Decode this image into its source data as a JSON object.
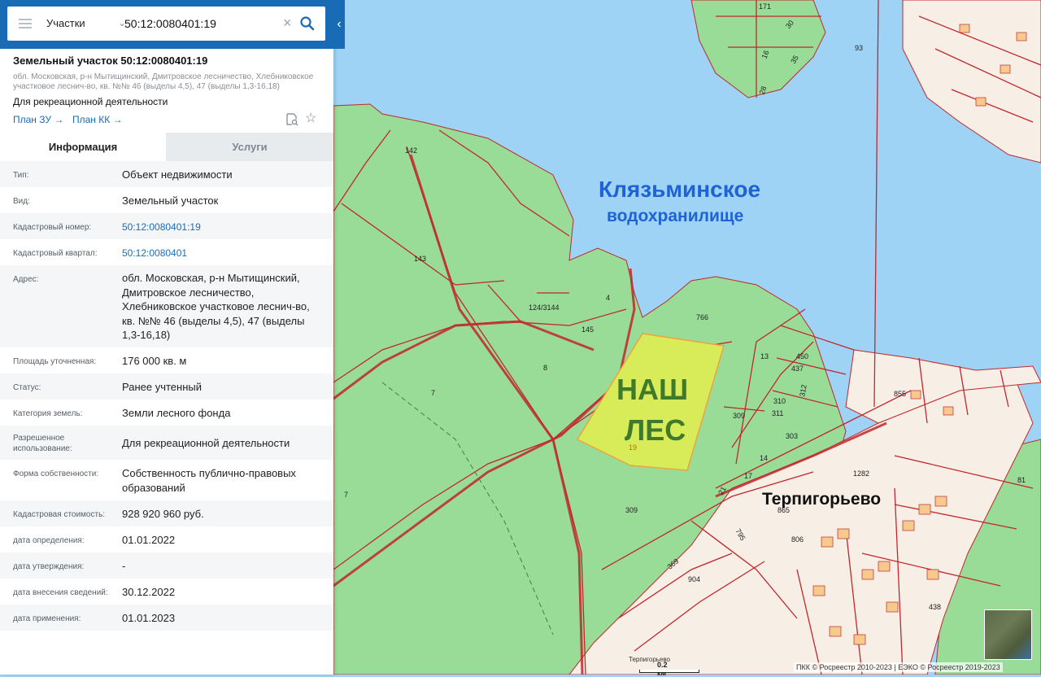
{
  "search": {
    "type_label": "Участки",
    "query": "50:12:0080401:19"
  },
  "parcel": {
    "title": "Земельный участок 50:12:0080401:19",
    "address_short": "обл. Московская, р-н Мытищинский, Дмитровское лесничество, Хлебниковское участковое леснич-во, кв. №№ 46 (выделы 4,5), 47 (выделы 1,3-16,18)",
    "use": "Для рекреационной деятельности",
    "links": {
      "plan_zu": "План ЗУ →",
      "plan_kk": "План КК →"
    }
  },
  "tabs": {
    "info": "Информация",
    "services": "Услуги"
  },
  "info_rows": [
    {
      "label": "Тип:",
      "value": "Объект недвижимости"
    },
    {
      "label": "Вид:",
      "value": "Земельный участок"
    },
    {
      "label": "Кадастровый номер:",
      "value": "50:12:0080401:19"
    },
    {
      "label": "Кадастровый квартал:",
      "value": "50:12:0080401"
    },
    {
      "label": "Адрес:",
      "value": "обл. Московская, р-н Мытищинский, Дмитровское лесничество, Хлебниковское участковое леснич-во, кв. №№ 46 (выделы 4,5), 47 (выделы 1,3-16,18)"
    },
    {
      "label": "Площадь уточненная:",
      "value": "176 000 кв. м"
    },
    {
      "label": "Статус:",
      "value": "Ранее учтенный"
    },
    {
      "label": "Категория земель:",
      "value": "Земли лесного фонда"
    },
    {
      "label": "Разрешенное использование:",
      "value": "Для рекреационной деятельности"
    },
    {
      "label": "Форма собственности:",
      "value": "Собственность публично-правовых образований"
    },
    {
      "label": "Кадастровая стоимость:",
      "value": "928 920 960 руб."
    },
    {
      "label": "дата определения:",
      "value": "01.01.2022"
    },
    {
      "label": "дата утверждения:",
      "value": "-"
    },
    {
      "label": "дата внесения сведений:",
      "value": "30.12.2022"
    },
    {
      "label": "дата применения:",
      "value": "01.01.2023"
    }
  ],
  "map": {
    "reservoir_line1": "Клязьминское",
    "reservoir_line2": "водохранилище",
    "forest_line1": "НАШ",
    "forest_line2": "ЛЕС",
    "village": "Терпигорьево",
    "village_small": "Терпигорьево",
    "parcel_numbers": [
      "171",
      "30",
      "93",
      "16",
      "35",
      "28",
      "142",
      "143",
      "124/3144",
      "4",
      "145",
      "766",
      "8",
      "7",
      "7",
      "13",
      "309",
      "309",
      "19",
      "1282",
      "904",
      "369",
      "795",
      "806",
      "865",
      "855",
      "438",
      "81",
      "450",
      "437",
      "310",
      "311",
      "312",
      "303",
      "14",
      "17",
      "21"
    ],
    "scale_label": "0.2 км",
    "attribution": "ПКК © Росреестр 2010-2023 | ЕЭКО © Росреестр 2019-2023",
    "colors": {
      "water": "#9fd3f5",
      "forest": "#98dc97",
      "highlight": "#d8ec5a",
      "boundary": "#c1272d",
      "urban": "#f7eee6"
    }
  }
}
